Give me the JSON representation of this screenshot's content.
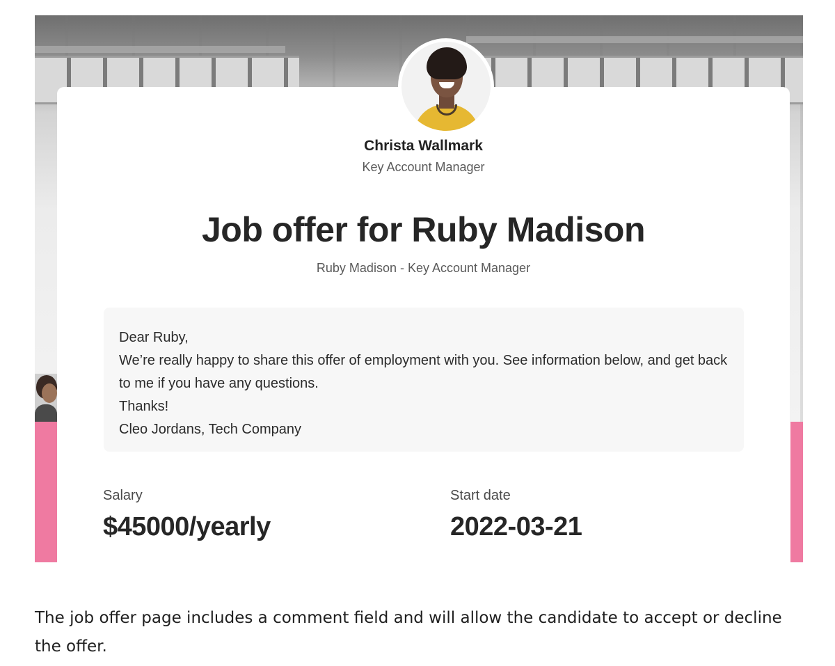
{
  "sender": {
    "name": "Christa Wallmark",
    "title": "Key Account Manager"
  },
  "offer": {
    "title": "Job offer for Ruby Madison",
    "subtitle": "Ruby Madison - Key Account Manager"
  },
  "message": {
    "lines": [
      "Dear Ruby,",
      "We’re really happy to share this offer of employment with you. See information below, and get back to me if you have any questions.",
      "Thanks!",
      "Cleo Jordans, Tech Company"
    ]
  },
  "details": {
    "salary_label": "Salary",
    "salary_value": "$45000/yearly",
    "start_label": "Start date",
    "start_value": "2022-03-21"
  },
  "caption": "The job offer page includes a comment field and will allow the candidate to accept or decline the offer.",
  "colors": {
    "accent_pink": "#ef7aa1",
    "message_bg": "#f7f7f7"
  }
}
